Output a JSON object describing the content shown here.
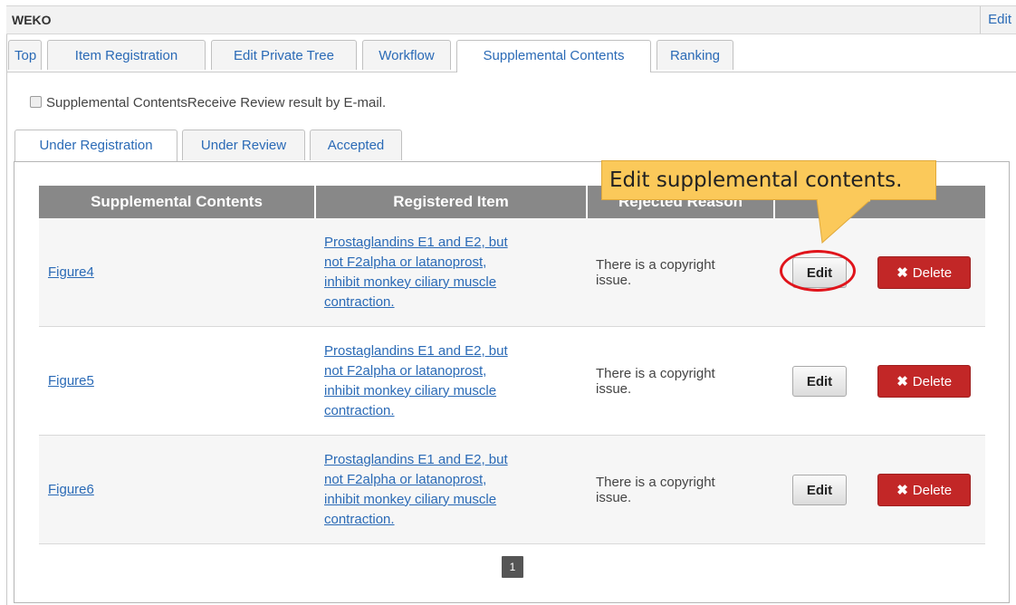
{
  "header": {
    "title": "WEKO",
    "edit_link": "Edit"
  },
  "main_tabs": [
    {
      "label": "Top"
    },
    {
      "label": "Item Registration"
    },
    {
      "label": "Edit Private Tree"
    },
    {
      "label": "Workflow"
    },
    {
      "label": "Supplemental Contents",
      "active": true
    },
    {
      "label": "Ranking"
    }
  ],
  "notify_checkbox": {
    "label": "Supplemental ContentsReceive Review result by E-mail.",
    "checked": false
  },
  "sub_tabs": [
    {
      "label": "Under Registration",
      "active": true
    },
    {
      "label": "Under Review"
    },
    {
      "label": "Accepted"
    }
  ],
  "table": {
    "headers": [
      "Supplemental Contents",
      "Registered Item",
      "Rejected Reason",
      ""
    ],
    "rows": [
      {
        "content": "Figure4",
        "item_lines": [
          "Prostaglandins E1 and E2, but",
          "not F2alpha or latanoprost,",
          "inhibit monkey ciliary muscle",
          "contraction."
        ],
        "reason_lines": [
          "There is a copyright",
          "issue."
        ],
        "edit_label": "Edit",
        "delete_label": "Delete"
      },
      {
        "content": "Figure5",
        "item_lines": [
          "Prostaglandins E1 and E2, but",
          "not F2alpha or latanoprost,",
          "inhibit monkey ciliary muscle",
          "contraction."
        ],
        "reason_lines": [
          "There is a copyright",
          "issue."
        ],
        "edit_label": "Edit",
        "delete_label": "Delete"
      },
      {
        "content": "Figure6",
        "item_lines": [
          "Prostaglandins E1 and E2, but",
          "not F2alpha or latanoprost,",
          "inhibit monkey ciliary muscle",
          "contraction."
        ],
        "reason_lines": [
          "There is a copyright",
          "issue."
        ],
        "edit_label": "Edit",
        "delete_label": "Delete"
      }
    ]
  },
  "pagination": {
    "current": "1"
  },
  "annotation": {
    "callout": "Edit supplemental contents.",
    "callout_color": "#fbc95a",
    "highlight_color": "#e0141b"
  },
  "colors": {
    "link": "#2a6ab6",
    "header_bg": "#888888",
    "delete_bg": "#c22727"
  }
}
